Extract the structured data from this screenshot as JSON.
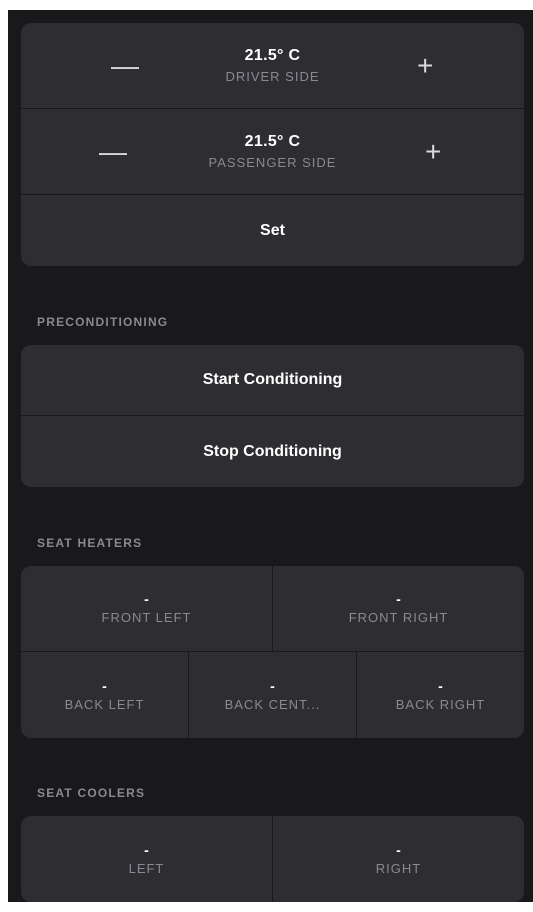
{
  "climate": {
    "driver": {
      "temp": "21.5° C",
      "label": "DRIVER SIDE",
      "minus": "—",
      "plus": "+"
    },
    "passenger": {
      "temp": "21.5° C",
      "label": "PASSENGER SIDE",
      "minus": "—",
      "plus": "+"
    },
    "set_label": "Set"
  },
  "preconditioning": {
    "heading": "PRECONDITIONING",
    "start_label": "Start Conditioning",
    "stop_label": "Stop Conditioning"
  },
  "seat_heaters": {
    "heading": "SEAT HEATERS",
    "front": [
      {
        "value": "-",
        "label": "FRONT LEFT"
      },
      {
        "value": "-",
        "label": "FRONT RIGHT"
      }
    ],
    "back": [
      {
        "value": "-",
        "label": "BACK LEFT"
      },
      {
        "value": "-",
        "label": "BACK CENT..."
      },
      {
        "value": "-",
        "label": "BACK RIGHT"
      }
    ]
  },
  "seat_coolers": {
    "heading": "SEAT COOLERS",
    "seats": [
      {
        "value": "-",
        "label": "LEFT"
      },
      {
        "value": "-",
        "label": "RIGHT"
      }
    ]
  },
  "colors": {
    "background": "#19191b",
    "card": "#2e2e32",
    "text_primary": "#ffffff",
    "text_secondary": "#8a8891"
  }
}
